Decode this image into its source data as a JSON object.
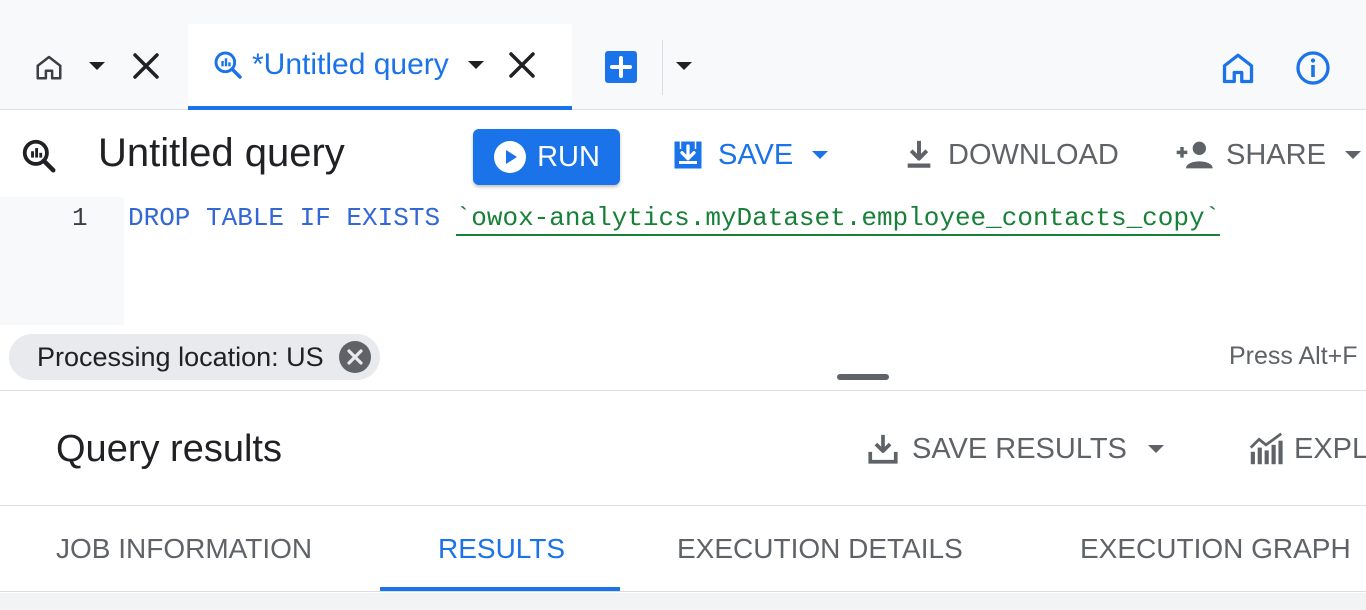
{
  "tabs": {
    "home_tab": {
      "icon": "home-icon"
    },
    "query_tab": {
      "label": "*Untitled query",
      "icon": "query-icon"
    }
  },
  "toolbar": {
    "title": "Untitled query",
    "run_label": "RUN",
    "save_label": "SAVE",
    "download_label": "DOWNLOAD",
    "share_label": "SHARE"
  },
  "editor": {
    "line_number": "1",
    "keywords": "DROP TABLE IF EXISTS",
    "table_ref": "`owox-analytics.myDataset.employee_contacts_copy`"
  },
  "location": {
    "chip_label": "Processing location: US",
    "hint": "Press Alt+F"
  },
  "results": {
    "title": "Query results",
    "save_results_label": "SAVE RESULTS",
    "explore_label": "EXPL",
    "tabs": [
      {
        "label": "JOB INFORMATION"
      },
      {
        "label": "RESULTS"
      },
      {
        "label": "EXECUTION DETAILS"
      },
      {
        "label": "EXECUTION GRAPH"
      }
    ]
  },
  "colors": {
    "accent": "#1a73e8",
    "keyword": "#3367d6",
    "string": "#188038",
    "muted": "#5f6368"
  }
}
